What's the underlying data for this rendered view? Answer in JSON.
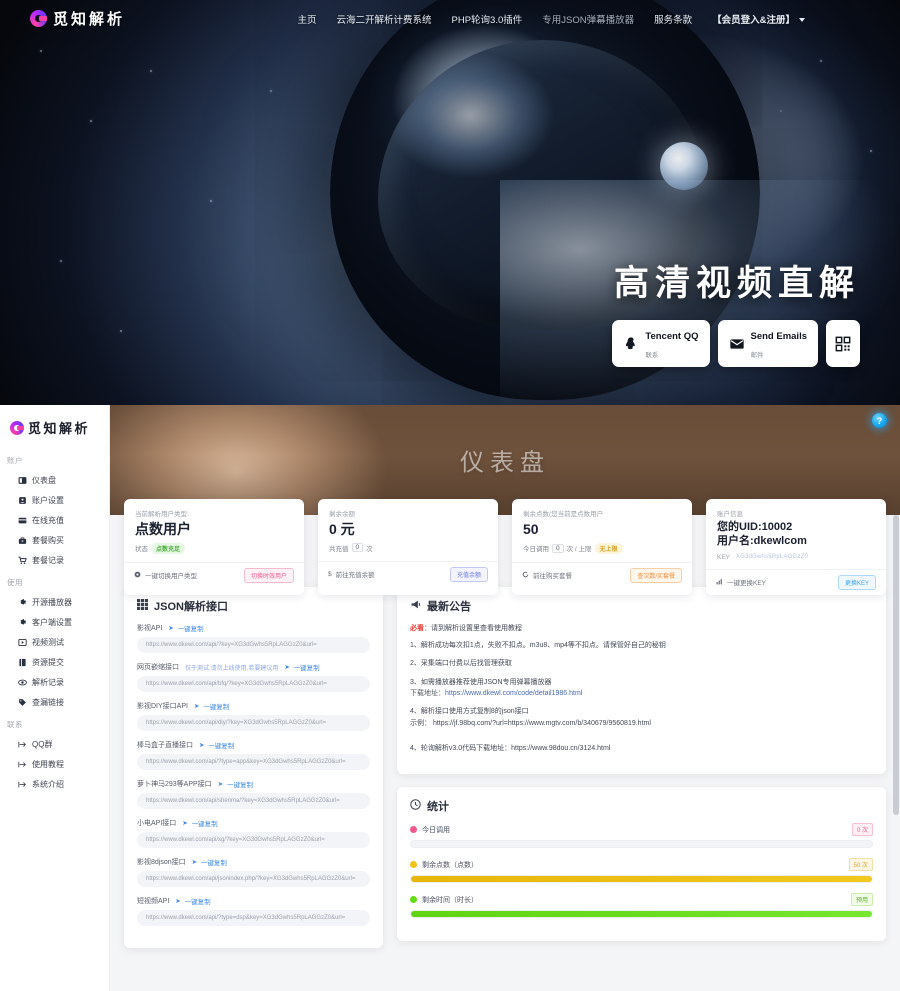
{
  "site": {
    "brand": "觅知解析",
    "nav": [
      {
        "label": "主页",
        "dim": false
      },
      {
        "label": "云海二开解析计费系统",
        "dim": false
      },
      {
        "label": "PHP轮询3.0插件",
        "dim": false
      },
      {
        "label": "专用JSON弹幕播放器",
        "dim": true
      },
      {
        "label": "服务条款",
        "dim": false
      },
      {
        "label": "【会员登入&注册】",
        "dim": false
      }
    ],
    "hero": {
      "title": "高清视频直解",
      "buttons": [
        {
          "icon": "qq-icon",
          "primary": "Tencent QQ",
          "secondary": "联系"
        },
        {
          "icon": "mail-icon",
          "primary": "Send Emails",
          "secondary": "邮件"
        },
        {
          "icon": "qrcode-icon",
          "primary": "",
          "secondary": ""
        }
      ]
    }
  },
  "sidebar": {
    "brand": "觅知解析",
    "groups": [
      {
        "title": "账户",
        "items": [
          {
            "label": "仪表盘",
            "icon": "dashboard-icon"
          },
          {
            "label": "账户设置",
            "icon": "user-card-icon"
          },
          {
            "label": "在线充值",
            "icon": "credit-card-icon"
          },
          {
            "label": "套餐购买",
            "icon": "briefcase-icon"
          },
          {
            "label": "套餐记录",
            "icon": "cart-icon"
          }
        ]
      },
      {
        "title": "使用",
        "items": [
          {
            "label": "开源播放器",
            "icon": "gear-icon"
          },
          {
            "label": "客户端设置",
            "icon": "gear-icon"
          },
          {
            "label": "视频测试",
            "icon": "play-icon"
          },
          {
            "label": "资源提交",
            "icon": "book-icon"
          },
          {
            "label": "解析记录",
            "icon": "eye-icon"
          },
          {
            "label": "查漏链接",
            "icon": "tag-icon"
          }
        ]
      },
      {
        "title": "联系",
        "items": [
          {
            "label": "QQ群",
            "icon": "arrow-right-icon"
          },
          {
            "label": "使用教程",
            "icon": "arrow-right-icon"
          },
          {
            "label": "系统介绍",
            "icon": "arrow-right-icon"
          }
        ]
      }
    ]
  },
  "banner": {
    "title": "仪表盘",
    "help_icon": "help-icon",
    "help_label": "?"
  },
  "cards": [
    {
      "label": "当前解析用户类型:",
      "value": "点数用户",
      "sub_prefix": "状态",
      "pill": "点数充足",
      "pill_color": "green",
      "foot_icon": "switch-icon",
      "foot_text": "一键切换用户类型",
      "foot_btn": "切换时效用户",
      "foot_btn_color": "pink"
    },
    {
      "label": "剩余余额",
      "value": "0 元",
      "sub_prefix": "共充值",
      "sub_box": "0",
      "sub_suffix": "次",
      "foot_icon": "dollar-icon",
      "foot_text": "前往充值余额",
      "foot_btn": "充值余额",
      "foot_btn_color": "violet"
    },
    {
      "label": "剩余点数(您当前是点数用户",
      "value": "50",
      "sub_prefix": "今日调用",
      "sub_box": "0",
      "sub_mid": "次 / 上限",
      "pill": "无上限",
      "pill_color": "yellow",
      "foot_icon": "refresh-icon",
      "foot_text": "前往购买套餐",
      "foot_btn": "查次数/买套餐",
      "foot_btn_color": "orange"
    },
    {
      "label": "账户信息",
      "value_line1": "您的UID:10002",
      "value_line2": "用户名:dkewlcom",
      "key_label": "KEY",
      "key_value": "XG3dGwhs5RpLAGGzZ0",
      "foot_icon": "signal-icon",
      "foot_text": "一键更换KEY",
      "foot_btn": "更换KEY",
      "foot_btn_color": "blue"
    }
  ],
  "json_panel": {
    "icon": "grid-icon",
    "title": "JSON解析接口",
    "copy_label": "一键复制",
    "rows": [
      {
        "name": "影视API",
        "note": "",
        "url": "https://www.dkewl.com/api/?key=XG3dGwhs5RpLAGGzZ0&url="
      },
      {
        "name": "网页嵌缩接口",
        "note": "仅于测试,请勿上线使用,若要建议用",
        "url": "https://www.dkewl.com/api/bfq/?key=XG3dGwhs5RpLAGGzZ0&url="
      },
      {
        "name": "影视DIY接口API",
        "note": "",
        "url": "https://www.dkewl.com/api/diy/?key=XG3dGwhs5RpLAGGzZ0&url="
      },
      {
        "name": "棒马盒子直播接口",
        "note": "",
        "url": "https://www.dkewl.com/api/?type=app&key=XG3dGwhs5RpLAGGzZ0&url="
      },
      {
        "name": "萝卜神马293等APP接口",
        "note": "",
        "url": "https://www.dkewl.com/api/shenma/?key=XG3dGwhs5RpLAGGzZ0&url="
      },
      {
        "name": "小电API接口",
        "note": "",
        "url": "https://www.dkewl.com/api/xg/?key=XG3dGwhs5RpLAGGzZ0&url="
      },
      {
        "name": "影视8djson接口",
        "note": "",
        "url": "https://www.dkewl.com/api/jsonindex.php/?key=XG3dGwhs5RpLAGGzZ0&url="
      },
      {
        "name": "短视频API",
        "note": "",
        "url": "https://www.dkewl.com/api/?type=dsp&key=XG3dGwhs5RpLAGGzZ0&url="
      }
    ]
  },
  "announcement": {
    "icon": "megaphone-icon",
    "title": "最新公告",
    "must_tag": "必看",
    "must_text": "：请到解析设置里查看使用教程",
    "items": [
      {
        "text": "1、解析成功每次扣1点，失败不扣点。m3u8、mp4等不扣点。请保管好自己的秘钥",
        "sub": "",
        "link": ""
      },
      {
        "text": "2、采集端口付费以后找管理获取",
        "sub": "",
        "link": ""
      },
      {
        "text": "3、如需播放器推荐使用JSON专用弹幕播放器",
        "sub": "下载地址：",
        "link": "https://www.dkewl.com/code/detail1986.html"
      },
      {
        "text": "4、解析接口使用方式复制8的json接口",
        "sub": "示例： https://jf.98bq.com/?url=https://www.mgtv.com/b/340679/9560819.html",
        "link": ""
      },
      {
        "text": "4、轮询解析v3.0代码下载地址：https://www.98dou.cn/3124.html",
        "sub": "",
        "link": ""
      }
    ]
  },
  "statistics": {
    "icon": "clock-icon",
    "title": "统计",
    "rows": [
      {
        "name": "今日调用",
        "badge": "0 次",
        "color": "#f05a8c",
        "percent": 0,
        "badge_color": "#f05a8c",
        "badge_bg": "#fdf0f4"
      },
      {
        "name": "剩余点数（点数）",
        "badge": "50 次",
        "color": "#e8b60a",
        "percent": 100,
        "badge_color": "#d8a42a",
        "badge_bg": "#fdf8e6"
      },
      {
        "name": "剩余时间（时长）",
        "badge": "预用",
        "color": "#64dd17",
        "percent": 100,
        "badge_color": "#55b81b",
        "badge_bg": "#f2fbe8"
      }
    ]
  }
}
